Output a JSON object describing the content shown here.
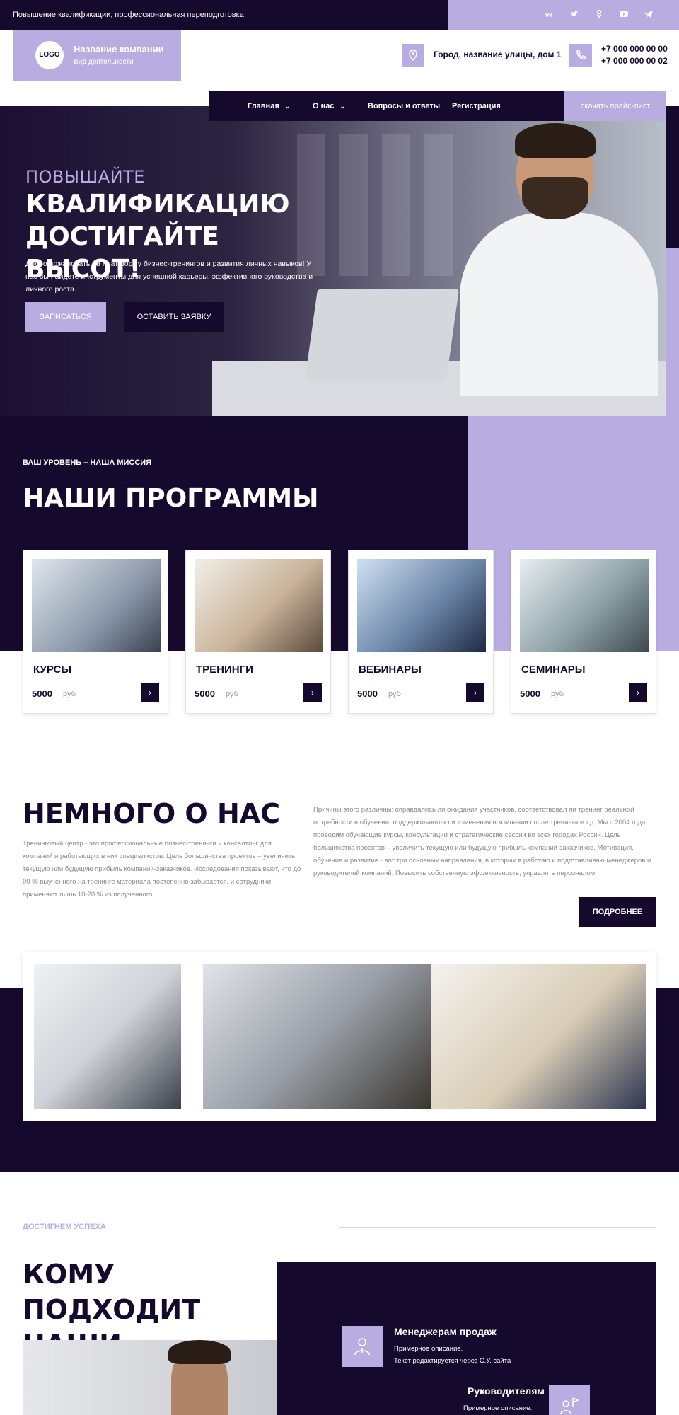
{
  "topbar": {
    "tagline": "Повышение квалификации, профессиональная переподготовка",
    "social": [
      "vk",
      "tw",
      "ok",
      "yt",
      "tg"
    ]
  },
  "header": {
    "logo": "LOGO",
    "company_name": "Название компании",
    "company_sub": "Вид деятельности",
    "address": "Город, название улицы, дом 1",
    "phone1": "+7 000 000 00 00",
    "phone2": "+7 000 000 00 02"
  },
  "nav": {
    "items": [
      "Главная",
      "О нас",
      "Вопросы и ответы",
      "Регистрация"
    ],
    "price_button": "скачать прайс-лист"
  },
  "hero": {
    "kicker": "ПОВЫШАЙТЕ",
    "title": "КВАЛИФИКАЦИЮ ДОСТИГАЙТЕ ВЫСОТ!",
    "text": "Добро пожаловать на платформу бизнес-тренингов и развития личных навыков! У нас вы найдете инструменты для успешной карьеры, эффективного руководства и личного роста.",
    "btn_primary": "ЗАПИСАТЬСЯ",
    "btn_secondary": "ОСТАВИТЬ ЗАЯВКУ"
  },
  "programs": {
    "kicker": "ВАШ УРОВЕНЬ – НАША МИССИЯ",
    "title": "НАШИ ПРОГРАММЫ",
    "cards": [
      {
        "title": "КУРСЫ",
        "price": "5000",
        "currency": "руб"
      },
      {
        "title": "ТРЕНИНГИ",
        "price": "5000",
        "currency": "руб"
      },
      {
        "title": "ВЕБИНАРЫ",
        "price": "5000",
        "currency": "руб"
      },
      {
        "title": "СЕМИНАРЫ",
        "price": "5000",
        "currency": "руб"
      }
    ]
  },
  "about": {
    "title": "НЕМНОГО О НАС",
    "left_text": "Тренинговый центр - это профессиональные бизнес-тренинги и консалтинг для компаний и работающих в них специалистов. Цель большинства проектов – увеличить текущую или будущую прибыль компаний-заказчиков. Исследования показывают, что до 90 % выученного на тренинге материала постепенно забывается, и сотрудники применяют лишь 10-20 % из полученного.",
    "right_text": "Причины этого различны: оправдались ли ожидания участников, соответствовал ли тренинг реальной потребности в обучении, поддерживаются ли изменения в компании после тренинга и т.д. Мы с 2004 года проводим обучающие курсы, консультации и стратегические сессии во всех городах России. Цель большинства проектов – увеличить текущую или будущую прибыль компаний-заказчиков. Мотивация, обучение и развитие - вот три основных направления, в которых я работаю и подготавливаю менеджеров и руководителей компаний. Повысить собственную эффективность, управлять персоналом",
    "more_button": "ПОДРОБНЕЕ"
  },
  "who": {
    "kicker": "ДОСТИГНЕМ УСПЕХА",
    "title": "КОМУ ПОДХОДИТ НАШИ КУРСЫ?",
    "roles": [
      {
        "title": "Менеджерам продаж",
        "desc1": "Примерное описание.",
        "desc2": "Текст редактируется через С.У. сайта"
      },
      {
        "title": "Руководителям",
        "desc1": "Примерное описание.",
        "desc2": ""
      }
    ]
  },
  "colors": {
    "dark": "#16092e",
    "accent": "#b9ace0"
  }
}
